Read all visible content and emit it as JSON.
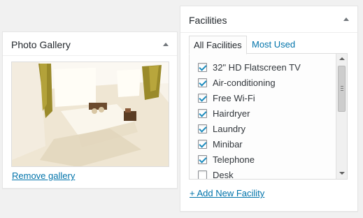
{
  "gallery": {
    "title": "Photo Gallery",
    "remove_label": "Remove gallery",
    "photo_icon": "room-photo"
  },
  "facilities": {
    "title": "Facilities",
    "tabs": [
      {
        "label": "All Facilities",
        "active": true
      },
      {
        "label": "Most Used",
        "active": false
      }
    ],
    "items": [
      {
        "label": "32\" HD Flatscreen TV",
        "checked": true
      },
      {
        "label": "Air-conditioning",
        "checked": true
      },
      {
        "label": "Free Wi-Fi",
        "checked": true
      },
      {
        "label": "Hairdryer",
        "checked": true
      },
      {
        "label": "Laundry",
        "checked": true
      },
      {
        "label": "Minibar",
        "checked": true
      },
      {
        "label": "Telephone",
        "checked": true
      },
      {
        "label": "Desk",
        "checked": false
      }
    ],
    "add_label": "+ Add New Facility"
  },
  "colors": {
    "link": "#0073aa",
    "checkmark": "#1e8cbe",
    "background": "#f1f1f1"
  }
}
